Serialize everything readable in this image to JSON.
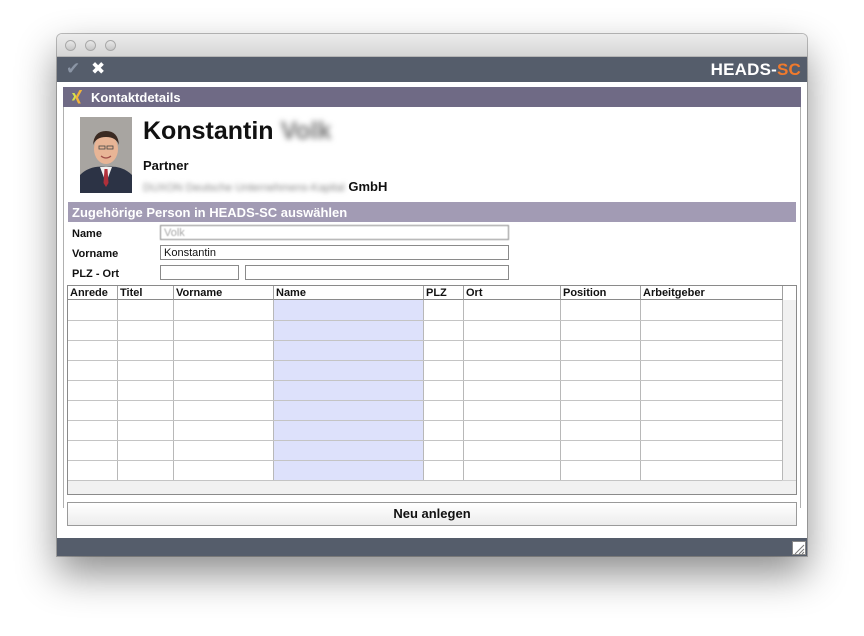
{
  "toolbar": {
    "confirm_icon": "checkmark-icon",
    "close_icon": "close-icon",
    "brand_main": "HEADS-",
    "brand_accent": "SC",
    "brand_accent_color": "#f07a2c"
  },
  "header": {
    "icon": "xing-icon",
    "title": "Kontaktdetails"
  },
  "contact": {
    "first_name": "Konstantin",
    "last_name": "Volk",
    "position": "Partner",
    "company_prefix": "DUXON Deutsche Unternehmens-Kapital",
    "company_suffix": "GmbH"
  },
  "section": {
    "title": "Zugehörige Person in HEADS-SC auswählen"
  },
  "form": {
    "name_label": "Name",
    "name_value": "Volk",
    "vorname_label": "Vorname",
    "vorname_value": "Konstantin",
    "plz_ort_label": "PLZ - Ort",
    "plz_value": "",
    "ort_value": ""
  },
  "grid": {
    "columns": [
      "Anrede",
      "Titel",
      "Vorname",
      "Name",
      "PLZ",
      "Ort",
      "Position",
      "Arbeitgeber"
    ],
    "highlight_column_color": "#dde1fb",
    "rows": []
  },
  "actions": {
    "new_label": "Neu anlegen"
  },
  "colors": {
    "toolbar_bg": "#555d6b",
    "header_bg": "#6f6a85",
    "section_bg": "#a29bb4"
  }
}
